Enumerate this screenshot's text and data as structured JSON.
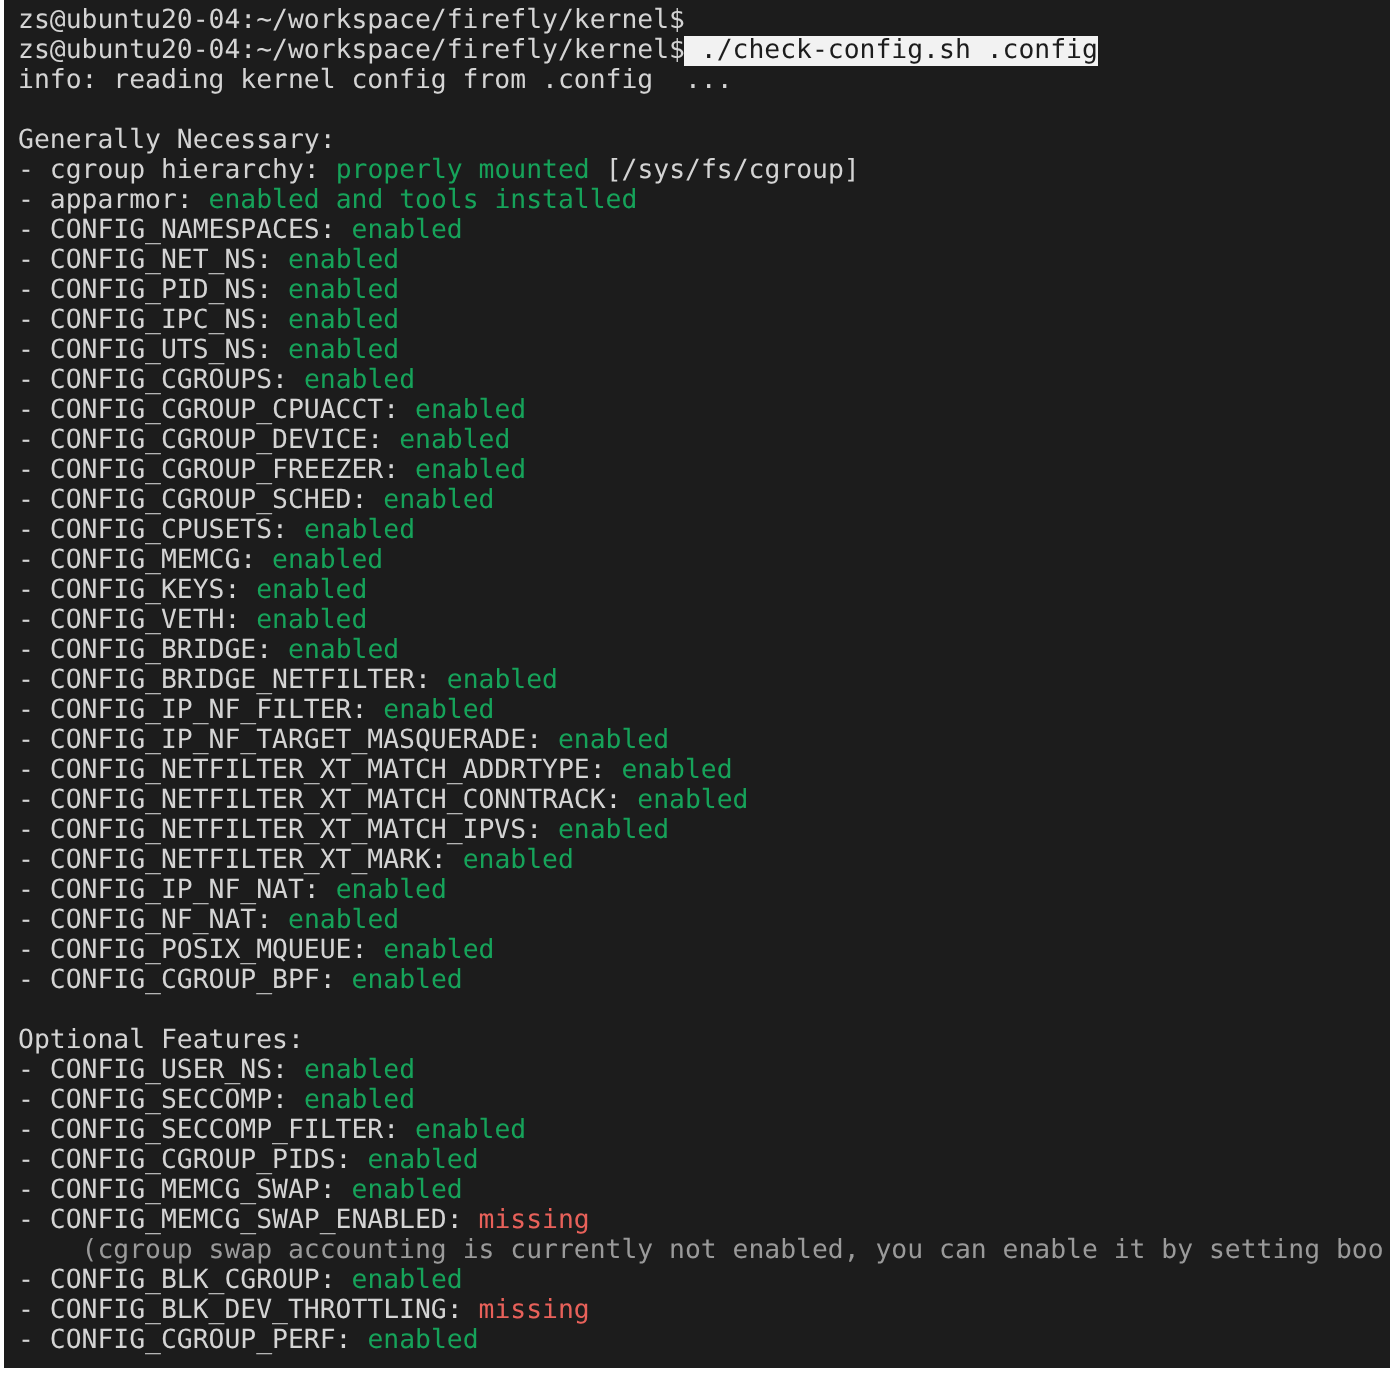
{
  "terminal": {
    "lines": [
      {
        "kind": "prompt",
        "prompt": "zs@ubuntu20-04:~/workspace/firefly/kernel$"
      },
      {
        "kind": "prompt",
        "prompt": "zs@ubuntu20-04:~/workspace/firefly/kernel$",
        "command": " ./check-config.sh .config"
      },
      {
        "kind": "info",
        "text": "info: reading kernel config from .config  ..."
      },
      {
        "kind": "blank"
      },
      {
        "kind": "heading",
        "text": "Generally Necessary:"
      },
      {
        "kind": "check",
        "name": "- cgroup hierarchy:",
        "color": "#16a35a",
        "value": "properly mounted",
        "suffix": "[/sys/fs/cgroup]"
      },
      {
        "kind": "check",
        "name": "- apparmor:",
        "color": "#16a35a",
        "value": "enabled and tools installed"
      },
      {
        "kind": "check",
        "name": "- CONFIG_NAMESPACES:",
        "color": "#16a35a",
        "value": "enabled"
      },
      {
        "kind": "check",
        "name": "- CONFIG_NET_NS:",
        "color": "#16a35a",
        "value": "enabled"
      },
      {
        "kind": "check",
        "name": "- CONFIG_PID_NS:",
        "color": "#16a35a",
        "value": "enabled"
      },
      {
        "kind": "check",
        "name": "- CONFIG_IPC_NS:",
        "color": "#16a35a",
        "value": "enabled"
      },
      {
        "kind": "check",
        "name": "- CONFIG_UTS_NS:",
        "color": "#16a35a",
        "value": "enabled"
      },
      {
        "kind": "check",
        "name": "- CONFIG_CGROUPS:",
        "color": "#16a35a",
        "value": "enabled"
      },
      {
        "kind": "check",
        "name": "- CONFIG_CGROUP_CPUACCT:",
        "color": "#16a35a",
        "value": "enabled"
      },
      {
        "kind": "check",
        "name": "- CONFIG_CGROUP_DEVICE:",
        "color": "#16a35a",
        "value": "enabled"
      },
      {
        "kind": "check",
        "name": "- CONFIG_CGROUP_FREEZER:",
        "color": "#16a35a",
        "value": "enabled"
      },
      {
        "kind": "check",
        "name": "- CONFIG_CGROUP_SCHED:",
        "color": "#16a35a",
        "value": "enabled"
      },
      {
        "kind": "check",
        "name": "- CONFIG_CPUSETS:",
        "color": "#16a35a",
        "value": "enabled"
      },
      {
        "kind": "check",
        "name": "- CONFIG_MEMCG:",
        "color": "#16a35a",
        "value": "enabled"
      },
      {
        "kind": "check",
        "name": "- CONFIG_KEYS:",
        "color": "#16a35a",
        "value": "enabled"
      },
      {
        "kind": "check",
        "name": "- CONFIG_VETH:",
        "color": "#16a35a",
        "value": "enabled"
      },
      {
        "kind": "check",
        "name": "- CONFIG_BRIDGE:",
        "color": "#16a35a",
        "value": "enabled"
      },
      {
        "kind": "check",
        "name": "- CONFIG_BRIDGE_NETFILTER:",
        "color": "#16a35a",
        "value": "enabled"
      },
      {
        "kind": "check",
        "name": "- CONFIG_IP_NF_FILTER:",
        "color": "#16a35a",
        "value": "enabled"
      },
      {
        "kind": "check",
        "name": "- CONFIG_IP_NF_TARGET_MASQUERADE:",
        "color": "#16a35a",
        "value": "enabled"
      },
      {
        "kind": "check",
        "name": "- CONFIG_NETFILTER_XT_MATCH_ADDRTYPE:",
        "color": "#16a35a",
        "value": "enabled"
      },
      {
        "kind": "check",
        "name": "- CONFIG_NETFILTER_XT_MATCH_CONNTRACK:",
        "color": "#16a35a",
        "value": "enabled"
      },
      {
        "kind": "check",
        "name": "- CONFIG_NETFILTER_XT_MATCH_IPVS:",
        "color": "#16a35a",
        "value": "enabled"
      },
      {
        "kind": "check",
        "name": "- CONFIG_NETFILTER_XT_MARK:",
        "color": "#16a35a",
        "value": "enabled"
      },
      {
        "kind": "check",
        "name": "- CONFIG_IP_NF_NAT:",
        "color": "#16a35a",
        "value": "enabled"
      },
      {
        "kind": "check",
        "name": "- CONFIG_NF_NAT:",
        "color": "#16a35a",
        "value": "enabled"
      },
      {
        "kind": "check",
        "name": "- CONFIG_POSIX_MQUEUE:",
        "color": "#16a35a",
        "value": "enabled"
      },
      {
        "kind": "check",
        "name": "- CONFIG_CGROUP_BPF:",
        "color": "#16a35a",
        "value": "enabled"
      },
      {
        "kind": "blank"
      },
      {
        "kind": "heading",
        "text": "Optional Features:"
      },
      {
        "kind": "check",
        "name": "- CONFIG_USER_NS:",
        "color": "#16a35a",
        "value": "enabled"
      },
      {
        "kind": "check",
        "name": "- CONFIG_SECCOMP:",
        "color": "#16a35a",
        "value": "enabled"
      },
      {
        "kind": "check",
        "name": "- CONFIG_SECCOMP_FILTER:",
        "color": "#16a35a",
        "value": "enabled"
      },
      {
        "kind": "check",
        "name": "- CONFIG_CGROUP_PIDS:",
        "color": "#16a35a",
        "value": "enabled"
      },
      {
        "kind": "check",
        "name": "- CONFIG_MEMCG_SWAP:",
        "color": "#16a35a",
        "value": "enabled"
      },
      {
        "kind": "check",
        "name": "- CONFIG_MEMCG_SWAP_ENABLED:",
        "color": "#e8615a",
        "value": "missing"
      },
      {
        "kind": "note",
        "text": "(cgroup swap accounting is currently not enabled, you can enable it by setting boo"
      },
      {
        "kind": "check",
        "name": "- CONFIG_BLK_CGROUP:",
        "color": "#16a35a",
        "value": "enabled"
      },
      {
        "kind": "check",
        "name": "- CONFIG_BLK_DEV_THROTTLING:",
        "color": "#e8615a",
        "value": "missing"
      },
      {
        "kind": "check",
        "name": "- CONFIG_CGROUP_PERF:",
        "color": "#16a35a",
        "value": "enabled"
      }
    ]
  }
}
